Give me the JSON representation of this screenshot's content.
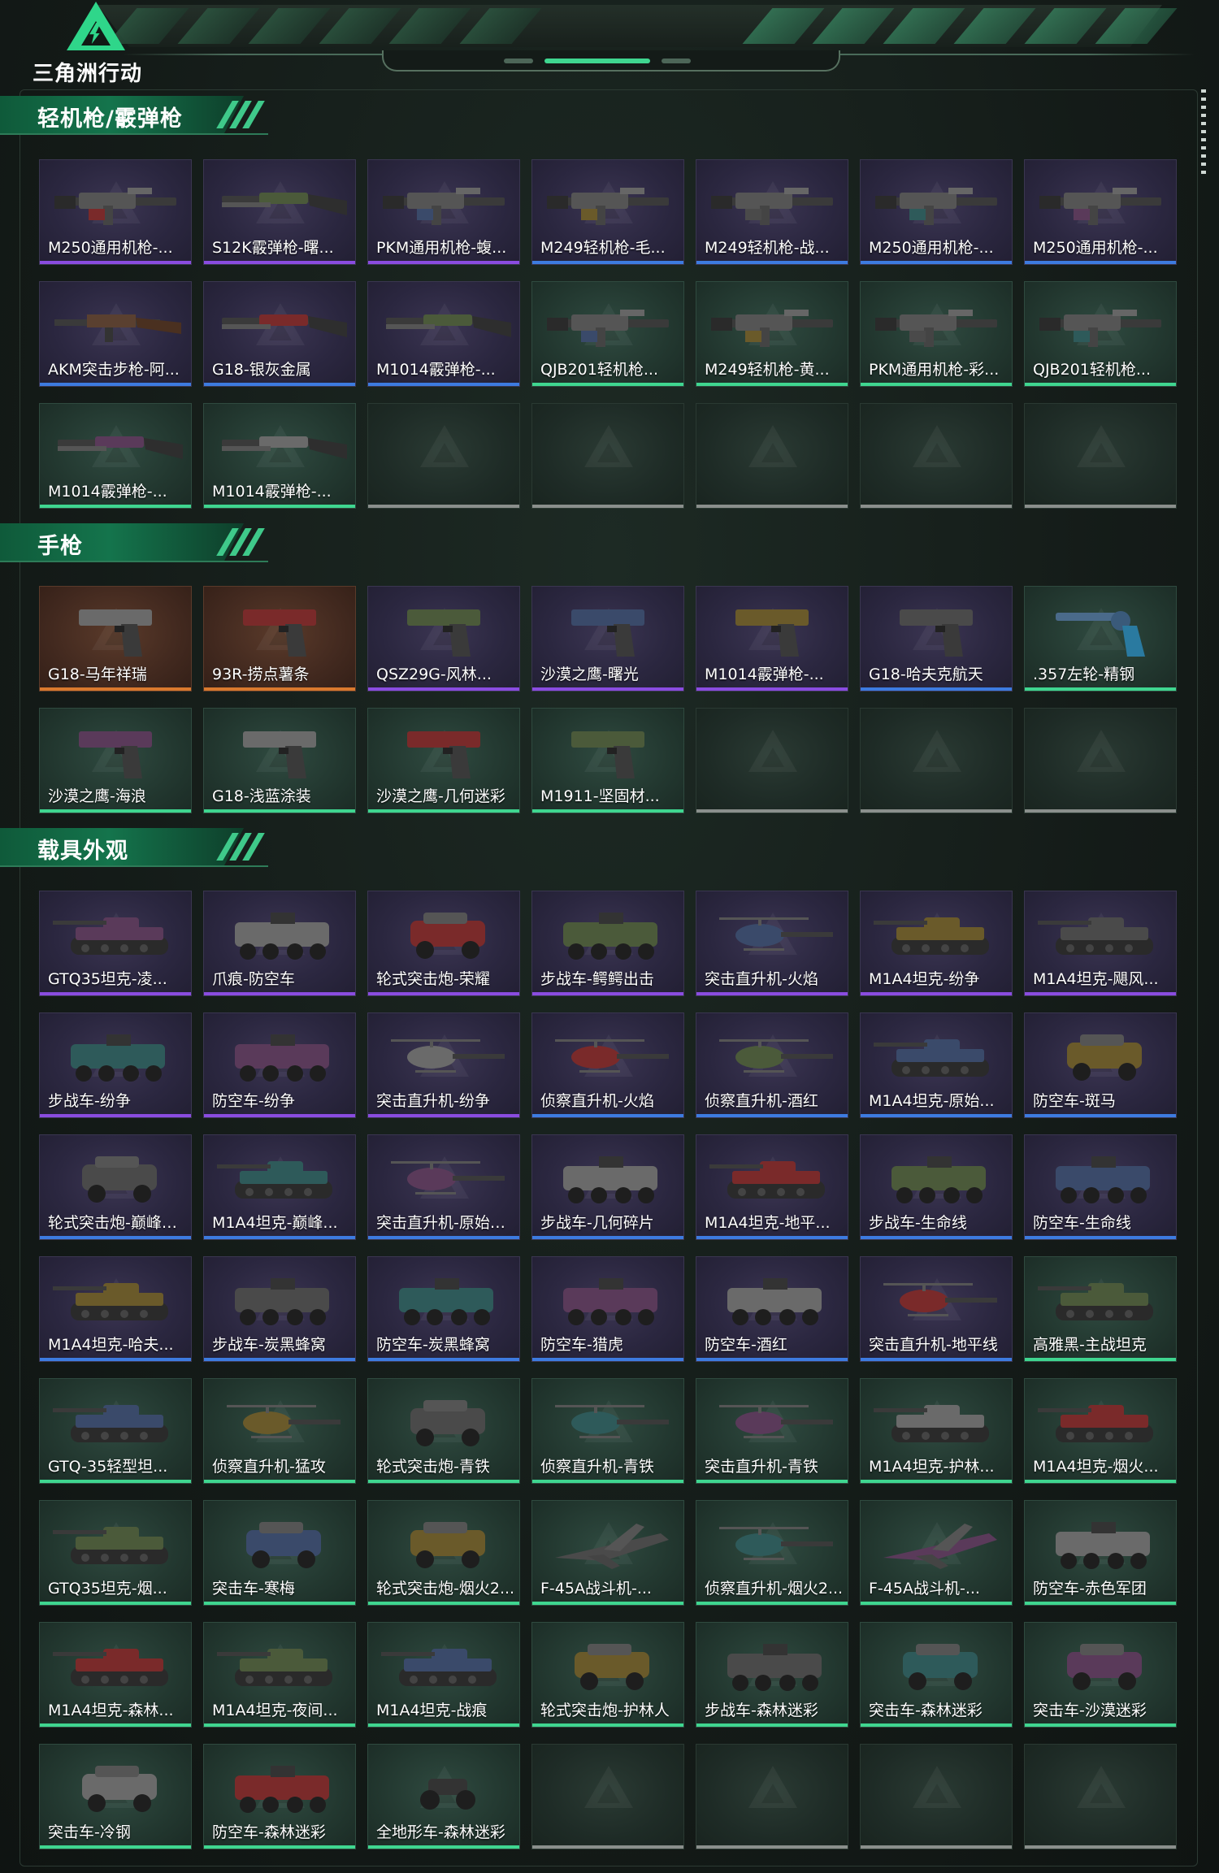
{
  "logo": {
    "text": "三角洲行动"
  },
  "colors": {
    "purple": "#8a4ce0",
    "blue": "#3d7be0",
    "green": "#3fd690",
    "orange": "#d9792e",
    "gray": "#8a8f8c"
  },
  "sections": [
    {
      "title": "轻机枪/霰弹枪",
      "items": [
        {
          "label": "M250通用机枪-...",
          "rarity": "purple",
          "icon": "machine-gun-icon"
        },
        {
          "label": "S12K霰弹枪-曙...",
          "rarity": "purple",
          "icon": "shotgun-icon"
        },
        {
          "label": "PKM通用机枪-蝮...",
          "rarity": "purple",
          "icon": "machine-gun-icon"
        },
        {
          "label": "M249轻机枪-毛...",
          "rarity": "blue",
          "icon": "machine-gun-icon"
        },
        {
          "label": "M249轻机枪-战...",
          "rarity": "blue",
          "icon": "machine-gun-icon"
        },
        {
          "label": "M250通用机枪-...",
          "rarity": "blue",
          "icon": "machine-gun-icon"
        },
        {
          "label": "M250通用机枪-...",
          "rarity": "blue",
          "icon": "machine-gun-icon"
        },
        {
          "label": "AKM突击步枪-阿...",
          "rarity": "blue",
          "icon": "rifle-icon"
        },
        {
          "label": "G18-银灰金属",
          "rarity": "blue",
          "icon": "shotgun-icon"
        },
        {
          "label": "M1014霰弹枪-...",
          "rarity": "blue",
          "icon": "shotgun-icon"
        },
        {
          "label": "QJB201轻机枪...",
          "rarity": "green",
          "icon": "machine-gun-icon"
        },
        {
          "label": "M249轻机枪-黄...",
          "rarity": "green",
          "icon": "machine-gun-icon"
        },
        {
          "label": "PKM通用机枪-彩...",
          "rarity": "green",
          "icon": "machine-gun-icon"
        },
        {
          "label": "QJB201轻机枪...",
          "rarity": "green",
          "icon": "machine-gun-icon"
        },
        {
          "label": "M1014霰弹枪-...",
          "rarity": "green",
          "icon": "shotgun-icon"
        },
        {
          "label": "M1014霰弹枪-...",
          "rarity": "green",
          "icon": "shotgun-icon"
        },
        {
          "label": "",
          "rarity": "empty",
          "icon": ""
        },
        {
          "label": "",
          "rarity": "empty",
          "icon": ""
        },
        {
          "label": "",
          "rarity": "empty",
          "icon": ""
        },
        {
          "label": "",
          "rarity": "empty",
          "icon": ""
        },
        {
          "label": "",
          "rarity": "empty",
          "icon": ""
        }
      ]
    },
    {
      "title": "手枪",
      "items": [
        {
          "label": "G18-马年祥瑞",
          "rarity": "orange",
          "icon": "pistol-icon"
        },
        {
          "label": "93R-捞点薯条",
          "rarity": "orange",
          "icon": "pistol-icon"
        },
        {
          "label": "QSZ29G-风林...",
          "rarity": "purple",
          "icon": "pistol-icon"
        },
        {
          "label": "沙漠之鹰-曙光",
          "rarity": "purple",
          "icon": "pistol-icon"
        },
        {
          "label": "M1014霰弹枪-...",
          "rarity": "purple",
          "icon": "pistol-icon"
        },
        {
          "label": "G18-哈夫克航天",
          "rarity": "blue",
          "icon": "pistol-icon"
        },
        {
          "label": ".357左轮-精钢",
          "rarity": "green",
          "icon": "revolver-icon"
        },
        {
          "label": "沙漠之鹰-海浪",
          "rarity": "green",
          "icon": "pistol-icon"
        },
        {
          "label": "G18-浅蓝涂装",
          "rarity": "green",
          "icon": "pistol-icon"
        },
        {
          "label": "沙漠之鹰-几何迷彩",
          "rarity": "green",
          "icon": "pistol-icon"
        },
        {
          "label": "M1911-坚固材...",
          "rarity": "green",
          "icon": "pistol-icon"
        },
        {
          "label": "",
          "rarity": "empty",
          "icon": ""
        },
        {
          "label": "",
          "rarity": "empty",
          "icon": ""
        },
        {
          "label": "",
          "rarity": "empty",
          "icon": ""
        }
      ]
    },
    {
      "title": "载具外观",
      "items": [
        {
          "label": "GTQ35坦克-凌...",
          "rarity": "purple",
          "icon": "tank-icon"
        },
        {
          "label": "爪痕-防空车",
          "rarity": "purple",
          "icon": "apc-icon"
        },
        {
          "label": "轮式突击炮-荣耀",
          "rarity": "purple",
          "icon": "jeep-icon"
        },
        {
          "label": "步战车-鳄鳄出击",
          "rarity": "purple",
          "icon": "apc-icon"
        },
        {
          "label": "突击直升机-火焰",
          "rarity": "purple",
          "icon": "helicopter-icon"
        },
        {
          "label": "M1A4坦克-纷争",
          "rarity": "purple",
          "icon": "tank-icon"
        },
        {
          "label": "M1A4坦克-飓风...",
          "rarity": "purple",
          "icon": "tank-icon"
        },
        {
          "label": "步战车-纷争",
          "rarity": "purple",
          "icon": "apc-icon"
        },
        {
          "label": "防空车-纷争",
          "rarity": "purple",
          "icon": "apc-icon"
        },
        {
          "label": "突击直升机-纷争",
          "rarity": "purple",
          "icon": "helicopter-icon"
        },
        {
          "label": "侦察直升机-火焰",
          "rarity": "blue",
          "icon": "helicopter-icon"
        },
        {
          "label": "侦察直升机-酒红",
          "rarity": "blue",
          "icon": "helicopter-icon"
        },
        {
          "label": "M1A4坦克-原始...",
          "rarity": "blue",
          "icon": "tank-icon"
        },
        {
          "label": "防空车-斑马",
          "rarity": "blue",
          "icon": "jeep-icon"
        },
        {
          "label": "轮式突击炮-巅峰竞...",
          "rarity": "blue",
          "icon": "jeep-icon"
        },
        {
          "label": "M1A4坦克-巅峰...",
          "rarity": "blue",
          "icon": "tank-icon"
        },
        {
          "label": "突击直升机-原始伪...",
          "rarity": "blue",
          "icon": "helicopter-icon"
        },
        {
          "label": "步战车-几何碎片",
          "rarity": "blue",
          "icon": "apc-icon"
        },
        {
          "label": "M1A4坦克-地平...",
          "rarity": "blue",
          "icon": "tank-icon"
        },
        {
          "label": "步战车-生命线",
          "rarity": "blue",
          "icon": "apc-icon"
        },
        {
          "label": "防空车-生命线",
          "rarity": "blue",
          "icon": "apc-icon"
        },
        {
          "label": "M1A4坦克-哈夫...",
          "rarity": "blue",
          "icon": "tank-icon"
        },
        {
          "label": "步战车-炭黑蜂窝",
          "rarity": "blue",
          "icon": "apc-icon"
        },
        {
          "label": "防空车-炭黑蜂窝",
          "rarity": "blue",
          "icon": "apc-icon"
        },
        {
          "label": "防空车-猎虎",
          "rarity": "blue",
          "icon": "apc-icon"
        },
        {
          "label": "防空车-酒红",
          "rarity": "blue",
          "icon": "apc-icon"
        },
        {
          "label": "突击直升机-地平线",
          "rarity": "blue",
          "icon": "helicopter-icon"
        },
        {
          "label": "高雅黑-主战坦克",
          "rarity": "green",
          "icon": "tank-icon"
        },
        {
          "label": "GTQ-35轻型坦...",
          "rarity": "green",
          "icon": "tank-icon"
        },
        {
          "label": "侦察直升机-猛攻",
          "rarity": "green",
          "icon": "helicopter-icon"
        },
        {
          "label": "轮式突击炮-青铁",
          "rarity": "green",
          "icon": "jeep-icon"
        },
        {
          "label": "侦察直升机-青铁",
          "rarity": "green",
          "icon": "helicopter-icon"
        },
        {
          "label": "突击直升机-青铁",
          "rarity": "green",
          "icon": "helicopter-icon"
        },
        {
          "label": "M1A4坦克-护林...",
          "rarity": "green",
          "icon": "tank-icon"
        },
        {
          "label": "M1A4坦克-烟火...",
          "rarity": "green",
          "icon": "tank-icon"
        },
        {
          "label": "GTQ35坦克-烟...",
          "rarity": "green",
          "icon": "tank-icon"
        },
        {
          "label": "突击车-寒梅",
          "rarity": "green",
          "icon": "jeep-icon"
        },
        {
          "label": "轮式突击炮-烟火2...",
          "rarity": "green",
          "icon": "jeep-icon"
        },
        {
          "label": "F-45A战斗机-...",
          "rarity": "green",
          "icon": "jet-icon"
        },
        {
          "label": "侦察直升机-烟火2...",
          "rarity": "green",
          "icon": "helicopter-icon"
        },
        {
          "label": "F-45A战斗机-...",
          "rarity": "green",
          "icon": "jet-icon"
        },
        {
          "label": "防空车-赤色军团",
          "rarity": "green",
          "icon": "apc-icon"
        },
        {
          "label": "M1A4坦克-森林...",
          "rarity": "green",
          "icon": "tank-icon"
        },
        {
          "label": "M1A4坦克-夜间...",
          "rarity": "green",
          "icon": "tank-icon"
        },
        {
          "label": "M1A4坦克-战痕",
          "rarity": "green",
          "icon": "tank-icon"
        },
        {
          "label": "轮式突击炮-护林人",
          "rarity": "green",
          "icon": "jeep-icon"
        },
        {
          "label": "步战车-森林迷彩",
          "rarity": "green",
          "icon": "apc-icon"
        },
        {
          "label": "突击车-森林迷彩",
          "rarity": "green",
          "icon": "jeep-icon"
        },
        {
          "label": "突击车-沙漠迷彩",
          "rarity": "green",
          "icon": "jeep-icon"
        },
        {
          "label": "突击车-冷钢",
          "rarity": "green",
          "icon": "jeep-icon"
        },
        {
          "label": "防空车-森林迷彩",
          "rarity": "green",
          "icon": "apc-icon"
        },
        {
          "label": "全地形车-森林迷彩",
          "rarity": "green",
          "icon": "atv-icon"
        },
        {
          "label": "",
          "rarity": "empty",
          "icon": ""
        },
        {
          "label": "",
          "rarity": "empty",
          "icon": ""
        },
        {
          "label": "",
          "rarity": "empty",
          "icon": ""
        },
        {
          "label": "",
          "rarity": "empty",
          "icon": ""
        }
      ]
    }
  ]
}
